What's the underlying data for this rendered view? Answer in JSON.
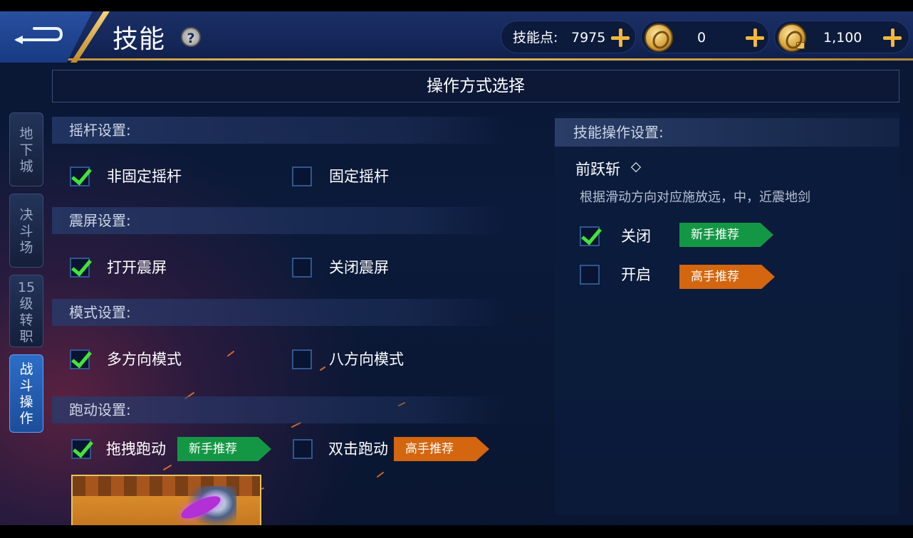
{
  "header": {
    "title": "技能",
    "help_glyph": "?",
    "skill_points_label": "技能点:",
    "skill_points_value": "7975",
    "gold": "0",
    "bound_gold": "1,100"
  },
  "op_bar_title": "操作方式选择",
  "tabs": [
    {
      "label": [
        "地",
        "下",
        "城"
      ],
      "active": false
    },
    {
      "label": [
        "决",
        "斗",
        "场"
      ],
      "active": false
    },
    {
      "label": [
        "15",
        "级",
        "转",
        "职"
      ],
      "active": false
    },
    {
      "label": [
        "战",
        "斗",
        "操",
        "作"
      ],
      "active": true
    }
  ],
  "sections": {
    "joystick": {
      "title": "摇杆设置:",
      "options": [
        {
          "label": "非固定摇杆",
          "checked": true
        },
        {
          "label": "固定摇杆",
          "checked": false
        }
      ]
    },
    "vibration": {
      "title": "震屏设置:",
      "options": [
        {
          "label": "打开震屏",
          "checked": true
        },
        {
          "label": "关闭震屏",
          "checked": false
        }
      ]
    },
    "mode": {
      "title": "模式设置:",
      "options": [
        {
          "label": "多方向模式",
          "checked": true
        },
        {
          "label": "八方向模式",
          "checked": false
        }
      ]
    },
    "run": {
      "title": "跑动设置:",
      "options": [
        {
          "label": "拖拽跑动",
          "checked": true,
          "badge": "新手推荐"
        },
        {
          "label": "双击跑动",
          "checked": false,
          "badge": "高手推荐"
        }
      ]
    }
  },
  "skill_panel": {
    "title": "技能操作设置:",
    "skill_name": "前跃斩",
    "description": "根据滑动方向对应施放远，中，近震地剑",
    "options": [
      {
        "label": "关闭",
        "checked": true,
        "badge": "新手推荐"
      },
      {
        "label": "开启",
        "checked": false,
        "badge": "高手推荐"
      }
    ]
  },
  "colors": {
    "check_green": "#43e33a",
    "badge_green": "#149745",
    "badge_orange": "#d3660f",
    "gold": "#f2b73a",
    "active_tab": "#2c6dc6"
  },
  "icons": {
    "back": "back-arrow-icon",
    "help": "help-icon",
    "plus": "plus-icon",
    "coin": "gold-coin-icon",
    "bound_coin": "bound-gold-coin-icon",
    "check": "checkmark-icon",
    "diamond": "diamond-icon"
  }
}
